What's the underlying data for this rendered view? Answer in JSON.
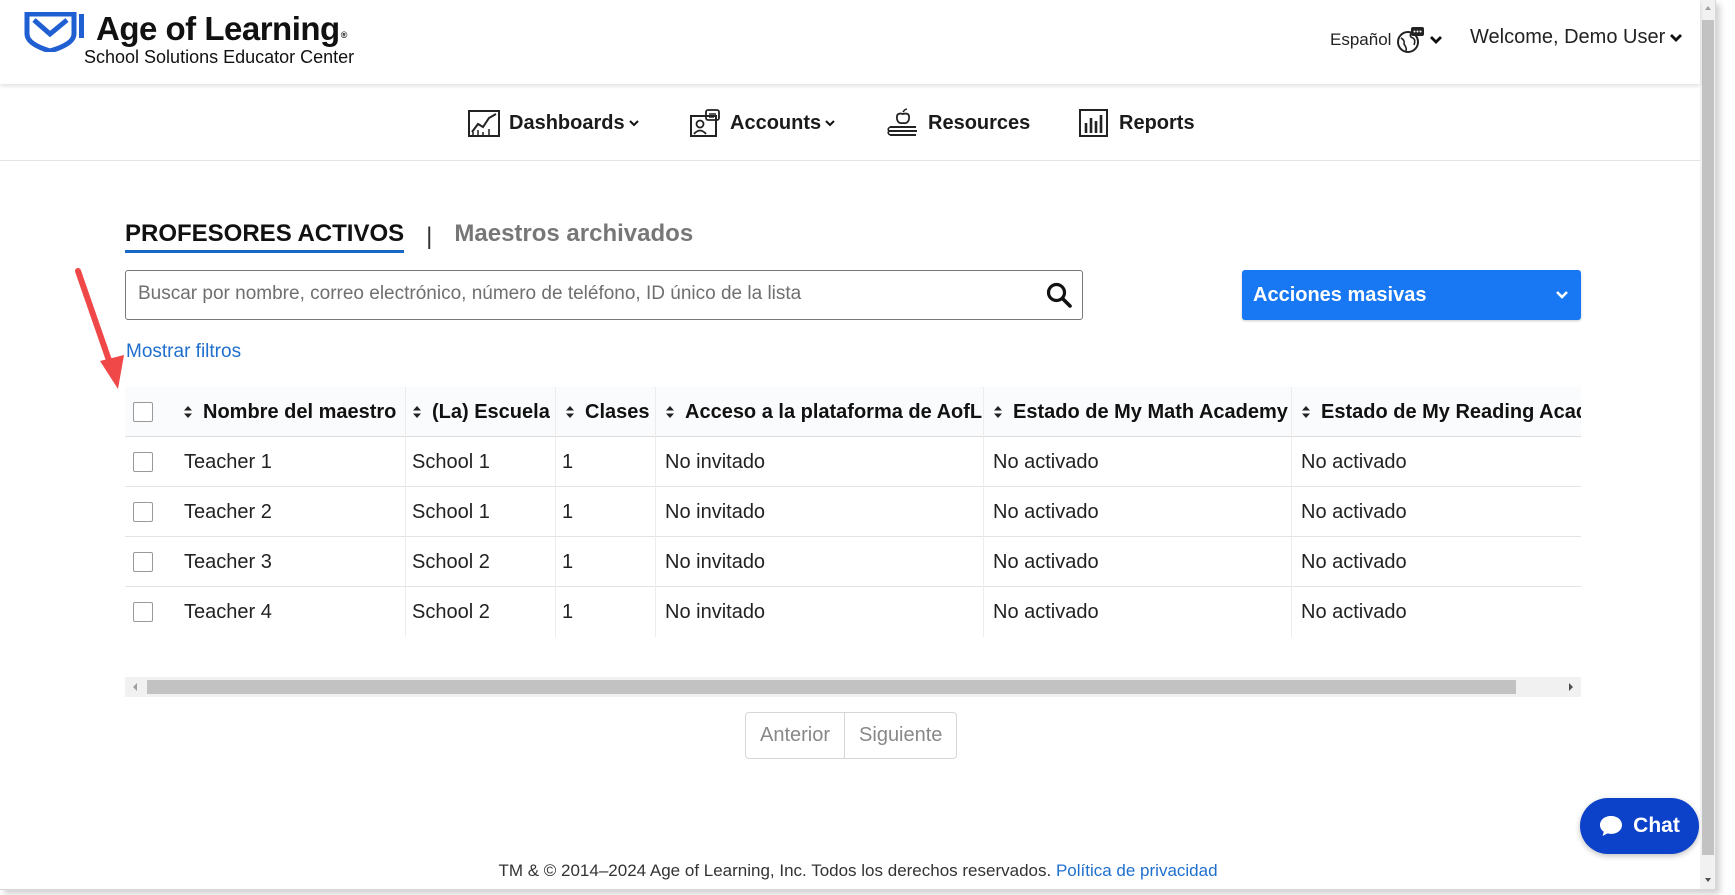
{
  "header": {
    "brand": "Age of Learning",
    "brand_mark": "®",
    "subtitle": "School Solutions Educator Center",
    "language": "Español",
    "welcome": "Welcome, Demo User"
  },
  "nav": {
    "items": [
      {
        "label": "Dashboards",
        "icon": "dashboard-chart-icon",
        "has_dropdown": true
      },
      {
        "label": "Accounts",
        "icon": "accounts-icon",
        "has_dropdown": true
      },
      {
        "label": "Resources",
        "icon": "resources-apple-books-icon",
        "has_dropdown": false
      },
      {
        "label": "Reports",
        "icon": "reports-bar-icon",
        "has_dropdown": false
      }
    ]
  },
  "tabs": {
    "active": "PROFESORES ACTIVOS",
    "separator": "|",
    "inactive": "Maestros archivados"
  },
  "search": {
    "placeholder": "Buscar por nombre, correo electrónico, número de teléfono, ID único de la lista",
    "value": ""
  },
  "bulk_actions": {
    "label": "Acciones masivas"
  },
  "filters_link": "Mostrar filtros",
  "table": {
    "columns": [
      "Nombre del maestro",
      "(La) Escuela",
      "Clases",
      "Acceso a la plataforma de AofL",
      "Estado de My Math Academy",
      "Estado de My Reading Academy"
    ],
    "rows": [
      {
        "name": "Teacher 1",
        "school": "School 1",
        "classes": "1",
        "access": "No invitado",
        "math": "No activado",
        "reading": "No activado"
      },
      {
        "name": "Teacher 2",
        "school": "School 1",
        "classes": "1",
        "access": "No invitado",
        "math": "No activado",
        "reading": "No activado"
      },
      {
        "name": "Teacher 3",
        "school": "School 2",
        "classes": "1",
        "access": "No invitado",
        "math": "No activado",
        "reading": "No activado"
      },
      {
        "name": "Teacher 4",
        "school": "School 2",
        "classes": "1",
        "access": "No invitado",
        "math": "No activado",
        "reading": "No activado"
      }
    ]
  },
  "pagination": {
    "prev": "Anterior",
    "next": "Siguiente"
  },
  "footer": {
    "text": "TM & © 2014–2024 Age of Learning, Inc. Todos los derechos reservados.",
    "privacy": "Política de privacidad"
  },
  "chat": {
    "label": "Chat"
  },
  "colors": {
    "accent_blue": "#1877f2",
    "link_blue": "#1f6fcf",
    "chat_blue": "#0c41c9",
    "logo_blue": "#1f5fd1",
    "annotation_red": "#f04848"
  }
}
